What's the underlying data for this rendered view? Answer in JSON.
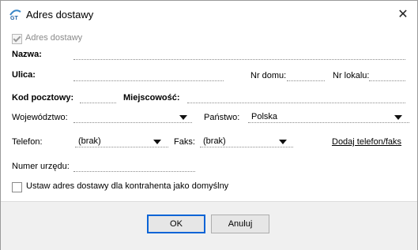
{
  "window": {
    "title": "Adres dostawy"
  },
  "form": {
    "enabled_checkbox": {
      "label": "Adres dostawy",
      "checked": true
    },
    "name": {
      "label": "Nazwa:",
      "value": ""
    },
    "street": {
      "label": "Ulica:",
      "value": ""
    },
    "house_no": {
      "label": "Nr domu:",
      "value": ""
    },
    "flat_no": {
      "label": "Nr lokalu:",
      "value": ""
    },
    "postcode": {
      "label": "Kod pocztowy:",
      "value": ""
    },
    "city": {
      "label": "Miejscowość:",
      "value": ""
    },
    "province": {
      "label": "Województwo:",
      "value": ""
    },
    "country": {
      "label": "Państwo:",
      "value": "Polska"
    },
    "phone": {
      "label": "Telefon:",
      "value": "(brak)"
    },
    "fax": {
      "label": "Faks:",
      "value": "(brak)"
    },
    "add_phone_link": "Dodaj telefon/faks",
    "office_no": {
      "label": "Numer urzędu:",
      "value": ""
    },
    "default_checkbox": {
      "label": "Ustaw adres dostawy dla kontrahenta jako domyślny",
      "checked": false
    }
  },
  "buttons": {
    "ok": "OK",
    "cancel": "Anuluj"
  }
}
